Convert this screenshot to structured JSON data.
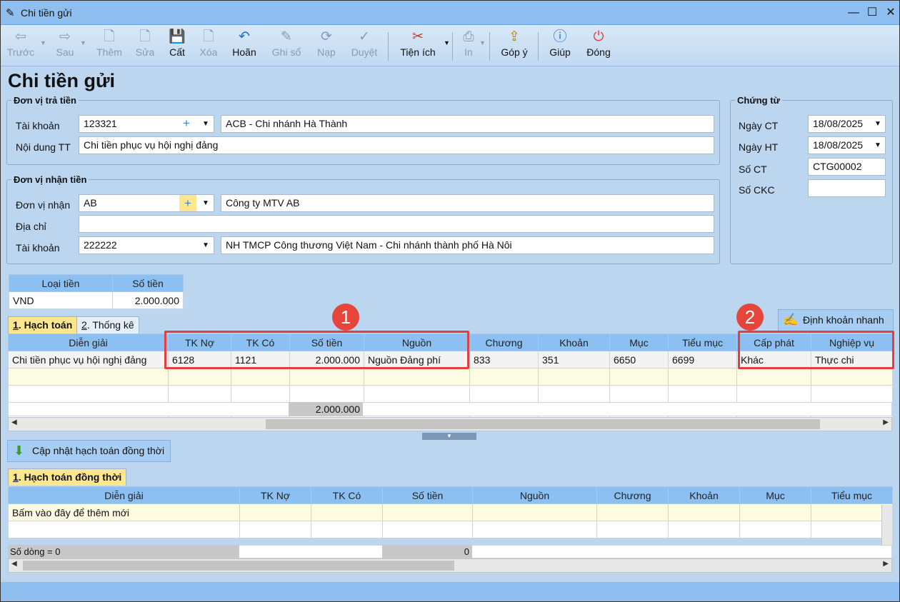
{
  "window": {
    "title": "Chi tiền gửi"
  },
  "toolbar": {
    "truoc": "Trước",
    "sau": "Sau",
    "them": "Thêm",
    "sua": "Sửa",
    "cat": "Cất",
    "xoa": "Xóa",
    "hoan": "Hoãn",
    "ghi_so": "Ghi sổ",
    "nap": "Nạp",
    "duyet": "Duyệt",
    "tien_ich": "Tiện ích",
    "in": "In",
    "gop_y": "Góp ý",
    "giup": "Giúp",
    "dong": "Đóng"
  },
  "page_title": "Chi tiền gửi",
  "payer": {
    "legend": "Đơn vị trả tiền",
    "account_label": "Tài khoản",
    "account_value": "123321",
    "account_name": "ACB - Chi nhánh Hà Thành",
    "content_label": "Nội dung TT",
    "content_value": "Chi tiền phục vụ hội nghị đảng"
  },
  "payee": {
    "legend": "Đơn vị nhận tiền",
    "unit_label": "Đơn vị nhận",
    "unit_value": "AB",
    "unit_name": "Công ty MTV AB",
    "address_label": "Địa chỉ",
    "address_value": "",
    "account_label": "Tài khoản",
    "account_value": "222222",
    "bank_name": "NH TMCP Công thương Việt Nam - Chi nhánh thành phố Hà Nôi"
  },
  "voucher": {
    "legend": "Chứng từ",
    "ngay_ct_label": "Ngày CT",
    "ngay_ct": "18/08/2025",
    "ngay_ht_label": "Ngày HT",
    "ngay_ht": "18/08/2025",
    "so_ct_label": "Số CT",
    "so_ct": "CTG00002",
    "so_ckc_label": "Số CKC",
    "so_ckc": ""
  },
  "currency": {
    "h_type": "Loại tiền",
    "h_amount": "Số tiền",
    "type": "VND",
    "amount": "2.000.000"
  },
  "tabs": {
    "hach_toan_num": "1",
    "hach_toan": ". Hạch toán",
    "thong_ke_num": "2",
    "thong_ke": ". Thống kê"
  },
  "quick_button": "Định khoản nhanh",
  "badges": {
    "one": "1",
    "two": "2"
  },
  "grid": {
    "headers": [
      "Diễn giải",
      "TK Nợ",
      "TK Có",
      "Số tiền",
      "Nguồn",
      "Chương",
      "Khoản",
      "Mục",
      "Tiểu mục",
      "Cấp phát",
      "Nghiệp vụ"
    ],
    "row": [
      "Chi tiền phục vụ hội nghị đảng",
      "6128",
      "1121",
      "2.000.000",
      "Nguồn Đảng phí",
      "833",
      "351",
      "6650",
      "6699",
      "Khác",
      "Thực chi"
    ],
    "total": "2.000.000"
  },
  "update_button": "Cập nhật hạch toán đồng thời",
  "tab2": {
    "num": "1",
    "label": ". Hạch toán đồng thời"
  },
  "grid2": {
    "headers": [
      "Diễn giải",
      "TK Nợ",
      "TK Có",
      "Số tiền",
      "Nguồn",
      "Chương",
      "Khoản",
      "Mục",
      "Tiểu mục"
    ],
    "add_new": "Bấm vào đây để thêm mới",
    "row_count": "Số dòng = 0",
    "total": "0"
  },
  "colors": {
    "accent_blue": "#8cc0f2",
    "highlight_yellow": "#fce78f",
    "marker_red": "#e04040"
  }
}
